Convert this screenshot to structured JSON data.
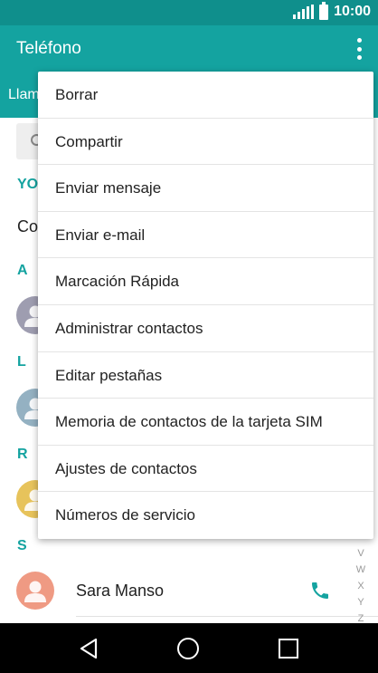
{
  "status_bar": {
    "time": "10:00"
  },
  "app_bar": {
    "title": "Teléfono",
    "overflow_icon": "more-vert-icon"
  },
  "tabs": {
    "visible_label": "Llam"
  },
  "sections": {
    "me_header": "YO",
    "me_item": "Co",
    "a": "A",
    "l": "L",
    "r": "R",
    "s": "S"
  },
  "contact": {
    "name": "Sara Manso",
    "icon": "phone-icon"
  },
  "alphabet_index": [
    "V",
    "W",
    "X",
    "Y",
    "Z"
  ],
  "menu": {
    "items": [
      "Borrar",
      "Compartir",
      "Enviar mensaje",
      "Enviar e-mail",
      "Marcación Rápida",
      "Administrar contactos",
      "Editar pestañas",
      "Memoria de contactos de la tarjeta SIM",
      "Ajustes de contactos",
      "Números de servicio"
    ]
  },
  "colors": {
    "status_bar": "#0f8f8c",
    "app_bar": "#14a3a0",
    "accent": "#14a3a0",
    "avatar_a": "#9e9db0",
    "avatar_l": "#94b1c2",
    "avatar_r": "#e7c35b",
    "avatar_s": "#ef9a83"
  }
}
